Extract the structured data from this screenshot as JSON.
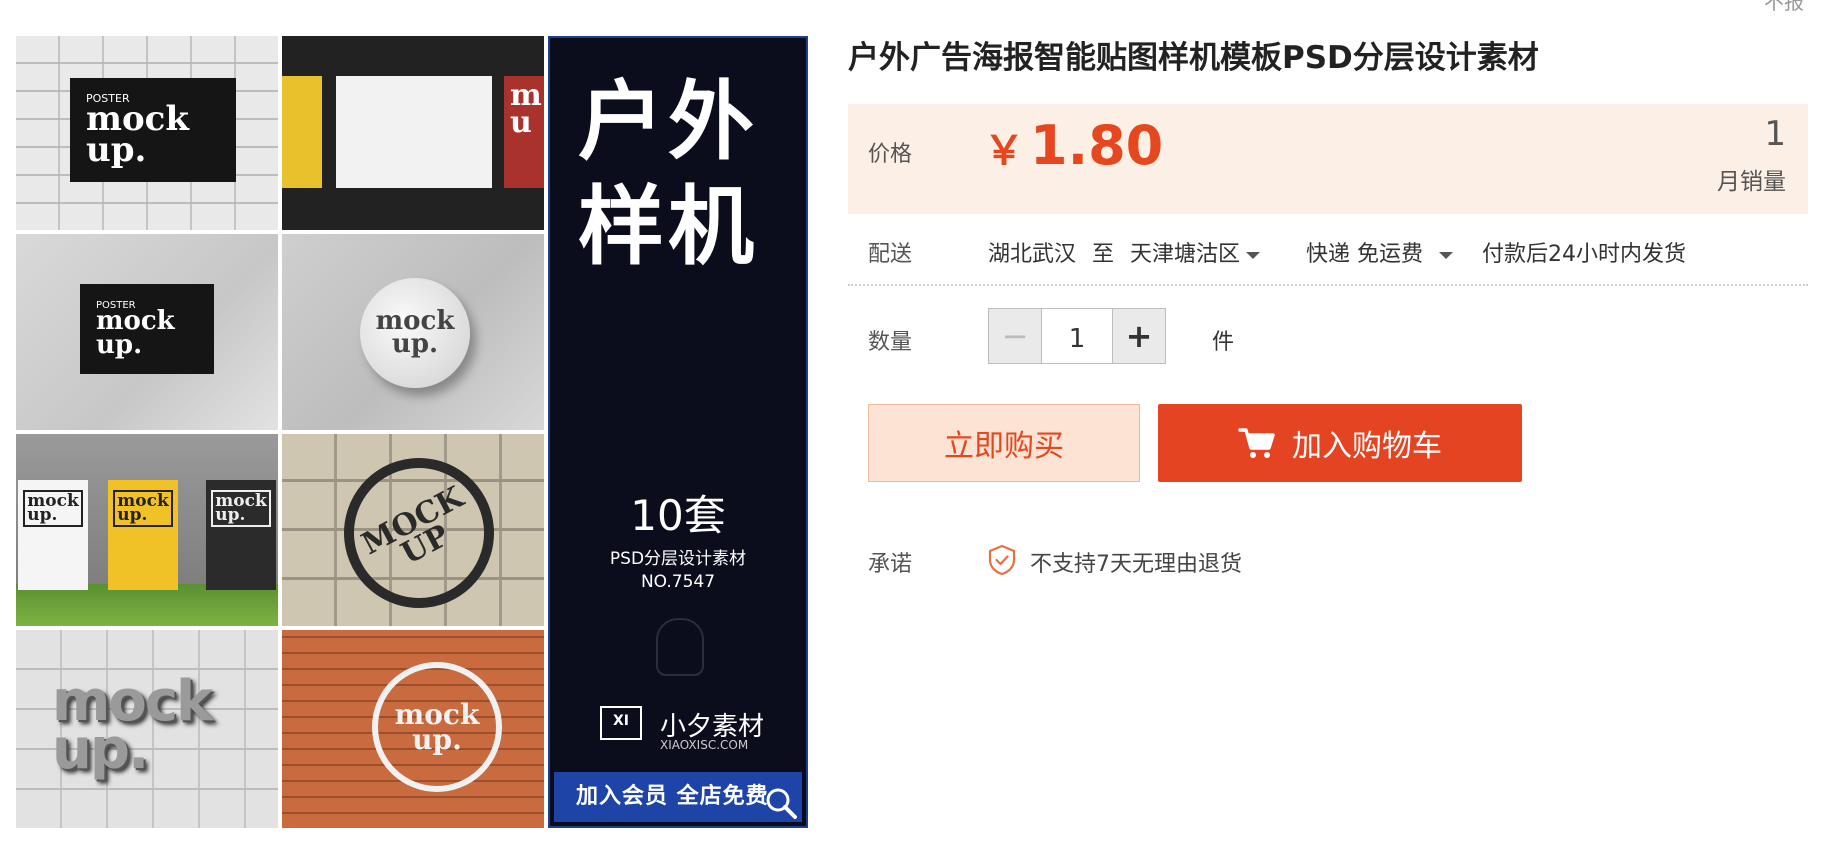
{
  "top_note": "不报",
  "product": {
    "title": "户外广告海报智能贴图样机模板PSD分层设计素材"
  },
  "gallery": {
    "tiles": {
      "t1_small": "POSTER",
      "t1_mock": "mock",
      "t1_up": "up.",
      "t3_small": "POSTER",
      "t3_mock": "mock",
      "t3_up": "up.",
      "t2_red_mock": "m",
      "t2_red_up": "u",
      "t4_mock": "mock",
      "t4_up": "up.",
      "t5_card1_mock": "mock",
      "t5_card1_up": "up.",
      "t5_card2_mock": "mock",
      "t5_card2_up": "up.",
      "t5_card3_mock": "mock",
      "t5_card3_up": "up.",
      "t6_mock": "MOCK",
      "t6_up": "UP",
      "t7_mock": "mock",
      "t7_up": "up.",
      "t8_mock": "mock",
      "t8_up": "up."
    },
    "banner": {
      "title_line1": "户外",
      "title_line2": "样机",
      "sets": "10套",
      "subtitle": "PSD分层设计素材",
      "number": "NO.7547",
      "logo": "XI",
      "brand": "小夕素材",
      "url": "XIAOXISC.COM",
      "cta": "加入会员 全店免费"
    }
  },
  "price": {
    "label": "价格",
    "currency": "￥",
    "value": "1.80",
    "sales_count": "1",
    "sales_label": "月销量"
  },
  "delivery": {
    "label": "配送",
    "origin": "湖北武汉",
    "to": "至",
    "destination": "天津塘沽区",
    "method": "快递 免运费",
    "ship_time": "付款后24小时内发货"
  },
  "quantity": {
    "label": "数量",
    "minus": "−",
    "plus": "+",
    "value": "1",
    "unit": "件"
  },
  "actions": {
    "buy_now": "立即购买",
    "add_to_cart": "加入购物车"
  },
  "promise": {
    "label": "承诺",
    "text": "不支持7天无理由退货"
  },
  "colors": {
    "accent": "#e54422",
    "price": "#e5471f",
    "price_bg": "#fcefe5",
    "buy_bg": "#fde3d3",
    "banner_bg": "#0b0d1c",
    "banner_cta": "#1e44a8"
  }
}
